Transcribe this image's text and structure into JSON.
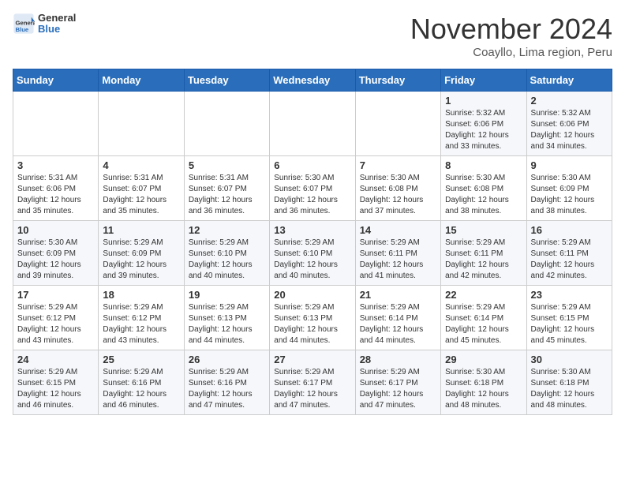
{
  "header": {
    "logo_line1": "General",
    "logo_line2": "Blue",
    "month_title": "November 2024",
    "subtitle": "Coayllo, Lima region, Peru"
  },
  "weekdays": [
    "Sunday",
    "Monday",
    "Tuesday",
    "Wednesday",
    "Thursday",
    "Friday",
    "Saturday"
  ],
  "weeks": [
    [
      {
        "day": "",
        "text": ""
      },
      {
        "day": "",
        "text": ""
      },
      {
        "day": "",
        "text": ""
      },
      {
        "day": "",
        "text": ""
      },
      {
        "day": "",
        "text": ""
      },
      {
        "day": "1",
        "text": "Sunrise: 5:32 AM\nSunset: 6:06 PM\nDaylight: 12 hours and 33 minutes."
      },
      {
        "day": "2",
        "text": "Sunrise: 5:32 AM\nSunset: 6:06 PM\nDaylight: 12 hours and 34 minutes."
      }
    ],
    [
      {
        "day": "3",
        "text": "Sunrise: 5:31 AM\nSunset: 6:06 PM\nDaylight: 12 hours and 35 minutes."
      },
      {
        "day": "4",
        "text": "Sunrise: 5:31 AM\nSunset: 6:07 PM\nDaylight: 12 hours and 35 minutes."
      },
      {
        "day": "5",
        "text": "Sunrise: 5:31 AM\nSunset: 6:07 PM\nDaylight: 12 hours and 36 minutes."
      },
      {
        "day": "6",
        "text": "Sunrise: 5:30 AM\nSunset: 6:07 PM\nDaylight: 12 hours and 36 minutes."
      },
      {
        "day": "7",
        "text": "Sunrise: 5:30 AM\nSunset: 6:08 PM\nDaylight: 12 hours and 37 minutes."
      },
      {
        "day": "8",
        "text": "Sunrise: 5:30 AM\nSunset: 6:08 PM\nDaylight: 12 hours and 38 minutes."
      },
      {
        "day": "9",
        "text": "Sunrise: 5:30 AM\nSunset: 6:09 PM\nDaylight: 12 hours and 38 minutes."
      }
    ],
    [
      {
        "day": "10",
        "text": "Sunrise: 5:30 AM\nSunset: 6:09 PM\nDaylight: 12 hours and 39 minutes."
      },
      {
        "day": "11",
        "text": "Sunrise: 5:29 AM\nSunset: 6:09 PM\nDaylight: 12 hours and 39 minutes."
      },
      {
        "day": "12",
        "text": "Sunrise: 5:29 AM\nSunset: 6:10 PM\nDaylight: 12 hours and 40 minutes."
      },
      {
        "day": "13",
        "text": "Sunrise: 5:29 AM\nSunset: 6:10 PM\nDaylight: 12 hours and 40 minutes."
      },
      {
        "day": "14",
        "text": "Sunrise: 5:29 AM\nSunset: 6:11 PM\nDaylight: 12 hours and 41 minutes."
      },
      {
        "day": "15",
        "text": "Sunrise: 5:29 AM\nSunset: 6:11 PM\nDaylight: 12 hours and 42 minutes."
      },
      {
        "day": "16",
        "text": "Sunrise: 5:29 AM\nSunset: 6:11 PM\nDaylight: 12 hours and 42 minutes."
      }
    ],
    [
      {
        "day": "17",
        "text": "Sunrise: 5:29 AM\nSunset: 6:12 PM\nDaylight: 12 hours and 43 minutes."
      },
      {
        "day": "18",
        "text": "Sunrise: 5:29 AM\nSunset: 6:12 PM\nDaylight: 12 hours and 43 minutes."
      },
      {
        "day": "19",
        "text": "Sunrise: 5:29 AM\nSunset: 6:13 PM\nDaylight: 12 hours and 44 minutes."
      },
      {
        "day": "20",
        "text": "Sunrise: 5:29 AM\nSunset: 6:13 PM\nDaylight: 12 hours and 44 minutes."
      },
      {
        "day": "21",
        "text": "Sunrise: 5:29 AM\nSunset: 6:14 PM\nDaylight: 12 hours and 44 minutes."
      },
      {
        "day": "22",
        "text": "Sunrise: 5:29 AM\nSunset: 6:14 PM\nDaylight: 12 hours and 45 minutes."
      },
      {
        "day": "23",
        "text": "Sunrise: 5:29 AM\nSunset: 6:15 PM\nDaylight: 12 hours and 45 minutes."
      }
    ],
    [
      {
        "day": "24",
        "text": "Sunrise: 5:29 AM\nSunset: 6:15 PM\nDaylight: 12 hours and 46 minutes."
      },
      {
        "day": "25",
        "text": "Sunrise: 5:29 AM\nSunset: 6:16 PM\nDaylight: 12 hours and 46 minutes."
      },
      {
        "day": "26",
        "text": "Sunrise: 5:29 AM\nSunset: 6:16 PM\nDaylight: 12 hours and 47 minutes."
      },
      {
        "day": "27",
        "text": "Sunrise: 5:29 AM\nSunset: 6:17 PM\nDaylight: 12 hours and 47 minutes."
      },
      {
        "day": "28",
        "text": "Sunrise: 5:29 AM\nSunset: 6:17 PM\nDaylight: 12 hours and 47 minutes."
      },
      {
        "day": "29",
        "text": "Sunrise: 5:30 AM\nSunset: 6:18 PM\nDaylight: 12 hours and 48 minutes."
      },
      {
        "day": "30",
        "text": "Sunrise: 5:30 AM\nSunset: 6:18 PM\nDaylight: 12 hours and 48 minutes."
      }
    ]
  ]
}
